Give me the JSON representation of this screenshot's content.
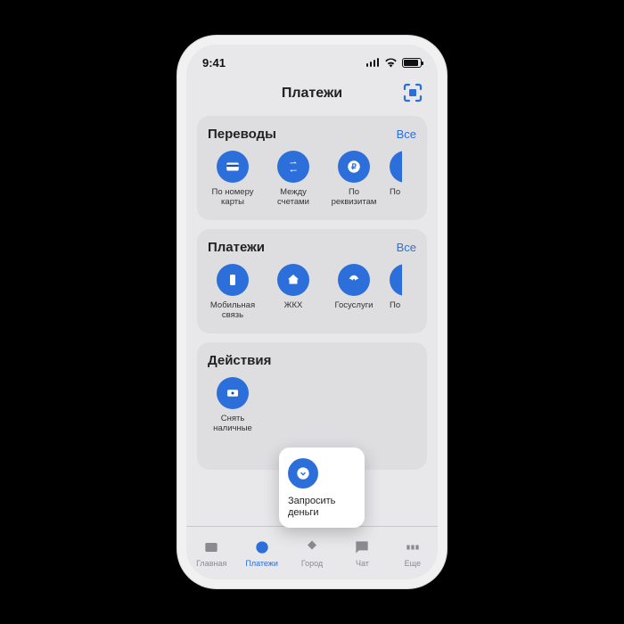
{
  "statusbar": {
    "time": "9:41"
  },
  "header": {
    "title": "Платежи"
  },
  "transfers": {
    "title": "Переводы",
    "all": "Все",
    "items": [
      {
        "label": "По номеру карты"
      },
      {
        "label": "Между счетами"
      },
      {
        "label": "По реквизитам"
      },
      {
        "label": "По"
      }
    ]
  },
  "payments": {
    "title": "Платежи",
    "all": "Все",
    "items": [
      {
        "label": "Мобильная связь"
      },
      {
        "label": "ЖКХ"
      },
      {
        "label": "Госуслуги"
      },
      {
        "label": "По"
      }
    ]
  },
  "actions": {
    "title": "Действия",
    "items": [
      {
        "label": "Снять наличные"
      },
      {
        "label": "Запросить деньги"
      }
    ]
  },
  "tabs": {
    "items": [
      {
        "label": "Главная"
      },
      {
        "label": "Платежи"
      },
      {
        "label": "Город"
      },
      {
        "label": "Чат"
      },
      {
        "label": "Еще"
      }
    ]
  }
}
